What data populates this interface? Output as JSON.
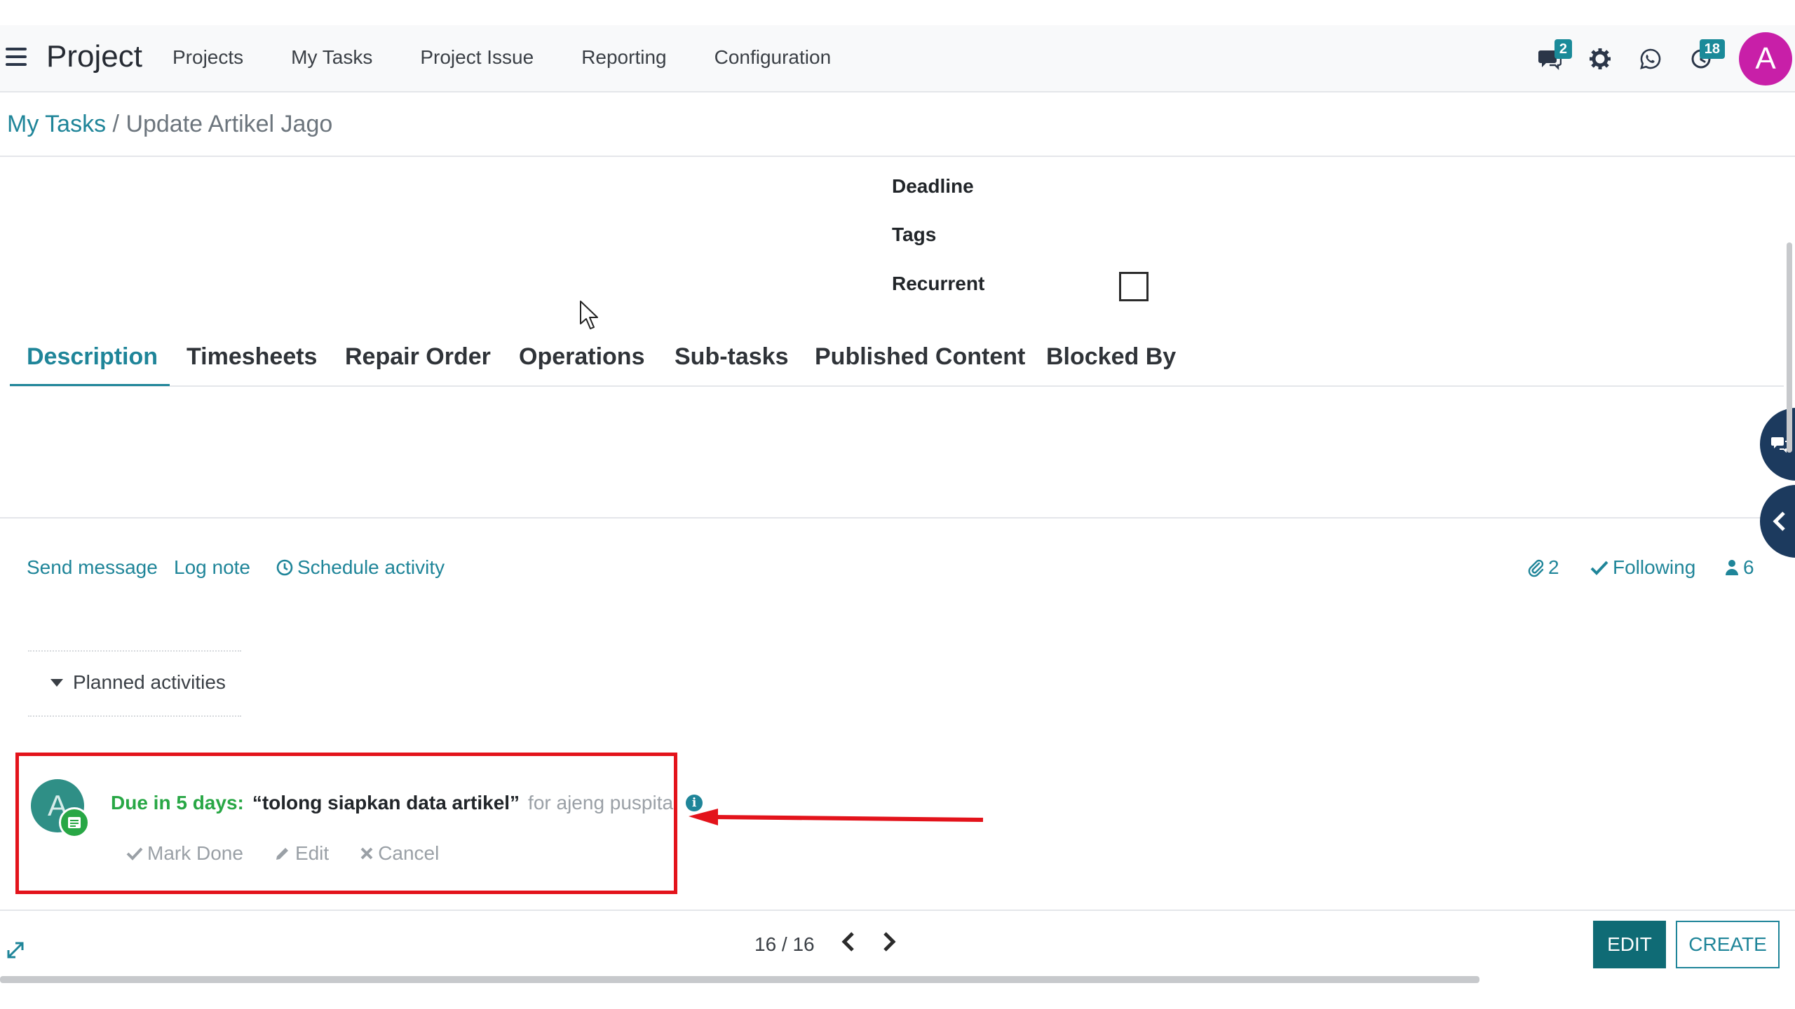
{
  "app": {
    "title": "Project"
  },
  "nav": {
    "items": [
      "Projects",
      "My Tasks",
      "Project Issue",
      "Reporting",
      "Configuration"
    ]
  },
  "systray": {
    "messages_count": "2",
    "activities_count": "18",
    "user_initial": "A"
  },
  "breadcrumb": {
    "parent": "My Tasks",
    "separator": "/",
    "current": "Update Artikel Jago"
  },
  "fields": {
    "deadline_label": "Deadline",
    "tags_label": "Tags",
    "recurrent_label": "Recurrent",
    "recurrent_checked": false
  },
  "tabs": [
    "Description",
    "Timesheets",
    "Repair Order",
    "Operations",
    "Sub-tasks",
    "Published Content",
    "Blocked By"
  ],
  "chatter": {
    "send_message": "Send message",
    "log_note": "Log note",
    "schedule_activity": "Schedule activity",
    "attachments_count": "2",
    "following": "Following",
    "followers_count": "6",
    "planned_activities": "Planned activities"
  },
  "activity": {
    "avatar_initial": "A",
    "due": "Due in 5 days:",
    "summary": "“tolong siapkan data artikel”",
    "assignee": "for ajeng puspita",
    "mark_done": "Mark Done",
    "edit": "Edit",
    "cancel": "Cancel"
  },
  "pager": {
    "value": "16 / 16"
  },
  "buttons": {
    "edit": "EDIT",
    "create": "CREATE"
  },
  "colors": {
    "accent": "#1f8599",
    "primary_button": "#0f6b75",
    "due_green": "#28a745",
    "highlight_red": "#e3131b",
    "avatar_magenta": "#c81fa8"
  }
}
